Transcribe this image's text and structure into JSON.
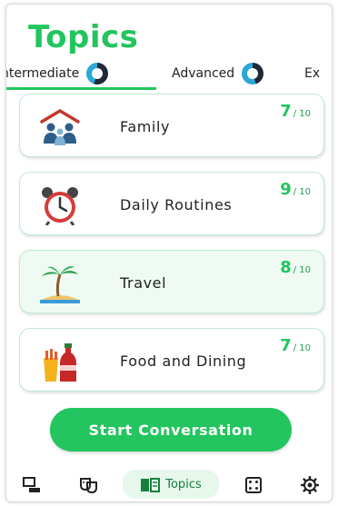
{
  "header": {
    "title": "Topics"
  },
  "levels": {
    "tabs": [
      {
        "label": "ntermediate",
        "active": true
      },
      {
        "label": "Advanced",
        "active": false
      },
      {
        "label": "Ex",
        "active": false
      }
    ]
  },
  "topics": [
    {
      "label": "Family",
      "score": "7",
      "total": "/ 10",
      "icon": "family-icon"
    },
    {
      "label": "Daily Routines",
      "score": "9",
      "total": "/ 10",
      "icon": "alarm-clock-icon"
    },
    {
      "label": "Travel",
      "score": "8",
      "total": "/ 10",
      "icon": "palm-beach-icon",
      "selected": true
    },
    {
      "label": "Food and Dining",
      "score": "7",
      "total": "/ 10",
      "icon": "food-drink-icon"
    }
  ],
  "actions": {
    "start_label": "Start Conversation"
  },
  "bottom_nav": {
    "items": [
      {
        "icon": "chat-icon"
      },
      {
        "icon": "masks-icon"
      },
      {
        "icon": "book-icon",
        "label": "Topics",
        "active": true
      },
      {
        "icon": "dice-icon"
      },
      {
        "icon": "settings-icon"
      }
    ]
  },
  "colors": {
    "accent": "#22c55e",
    "card_border": "#bfe9cf",
    "selected_bg": "#eefaf2"
  }
}
